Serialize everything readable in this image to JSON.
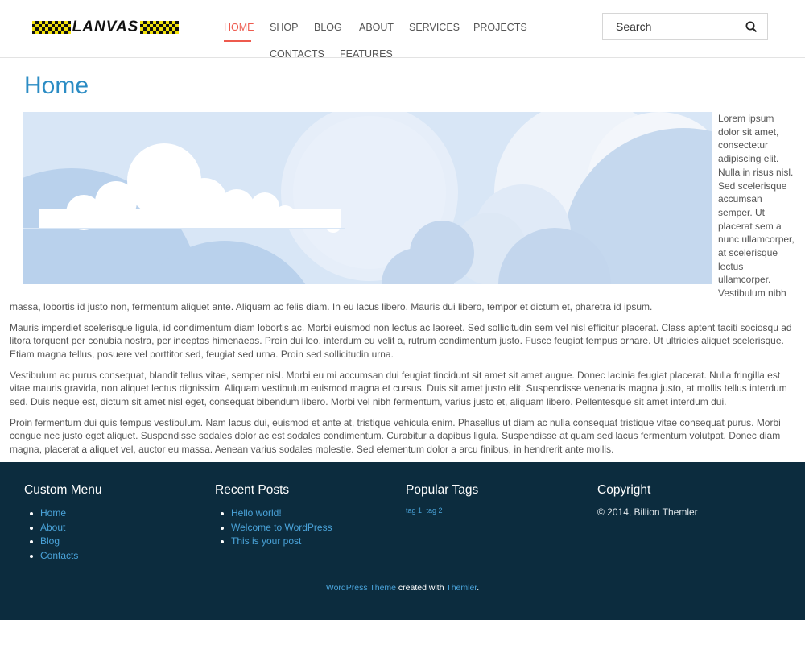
{
  "logo": {
    "text": "LANVAS"
  },
  "nav": {
    "items": [
      "HOME",
      "SHOP",
      "BLOG",
      "ABOUT",
      "SERVICES",
      "PROJECTS",
      "CONTACTS",
      "FEATURES"
    ],
    "active": "HOME",
    "active_color": "#ee5a4e"
  },
  "search": {
    "placeholder": "Search"
  },
  "page": {
    "title": "Home",
    "title_color": "#2b8cc4",
    "paragraphs": [
      "Lorem ipsum dolor sit amet, consectetur adipiscing elit. Nulla in risus nisl. Sed scelerisque accumsan semper. Ut placerat sem a nunc ullamcorper, at scelerisque lectus ullamcorper. Vestibulum nibh massa, lobortis id justo non, fermentum aliquet ante. Aliquam ac felis diam. In eu lacus libero. Mauris dui libero, tempor et dictum et, pharetra id ipsum.",
      "Mauris imperdiet scelerisque ligula, id condimentum diam lobortis ac. Morbi euismod non lectus ac laoreet. Sed sollicitudin sem vel nisl efficitur placerat. Class aptent taciti sociosqu ad litora torquent per conubia nostra, per inceptos himenaeos. Proin dui leo, interdum eu velit a, rutrum condimentum justo. Fusce feugiat tempus ornare. Ut ultricies aliquet scelerisque. Etiam magna tellus, posuere vel porttitor sed, feugiat sed urna. Proin sed sollicitudin urna.",
      "Vestibulum ac purus consequat, blandit tellus vitae, semper nisl. Morbi eu mi accumsan dui feugiat tincidunt sit amet sit amet augue. Donec lacinia feugiat placerat. Nulla fringilla est vitae mauris gravida, non aliquet lectus dignissim. Aliquam vestibulum euismod magna et cursus. Duis sit amet justo elit. Suspendisse venenatis magna justo, at mollis tellus interdum sed. Duis neque est, dictum sit amet nisl eget, consequat bibendum libero. Morbi vel nibh fermentum, varius justo et, aliquam libero. Pellentesque sit amet interdum dui.",
      "Proin fermentum dui quis tempus vestibulum. Nam lacus dui, euismod et ante at, tristique vehicula enim. Phasellus ut diam ac nulla consequat tristique vitae consequat purus. Morbi congue nec justo eget aliquet. Suspendisse sodales dolor ac est sodales condimentum. Curabitur a dapibus ligula. Suspendisse at quam sed lacus fermentum volutpat. Donec diam magna, placerat a aliquet vel, auctor eu massa. Aenean varius sodales molestie. Sed elementum dolor a arcu finibus, in hendrerit ante mollis."
    ]
  },
  "footer": {
    "background": "#0c2c3e",
    "link_color": "#4aa3d9",
    "custom_menu": {
      "title": "Custom Menu",
      "items": [
        "Home",
        "About",
        "Blog",
        "Contacts"
      ]
    },
    "recent_posts": {
      "title": "Recent Posts",
      "items": [
        "Hello world!",
        "Welcome to WordPress",
        "This is your post"
      ]
    },
    "popular_tags": {
      "title": "Popular Tags",
      "items": [
        "tag 1",
        "tag 2"
      ]
    },
    "copyright": {
      "title": "Copyright",
      "text": "© 2014, Billion Themler"
    },
    "credits": {
      "link1": "WordPress Theme",
      "middle": " created with ",
      "link2": "Themler",
      "end": "."
    }
  }
}
